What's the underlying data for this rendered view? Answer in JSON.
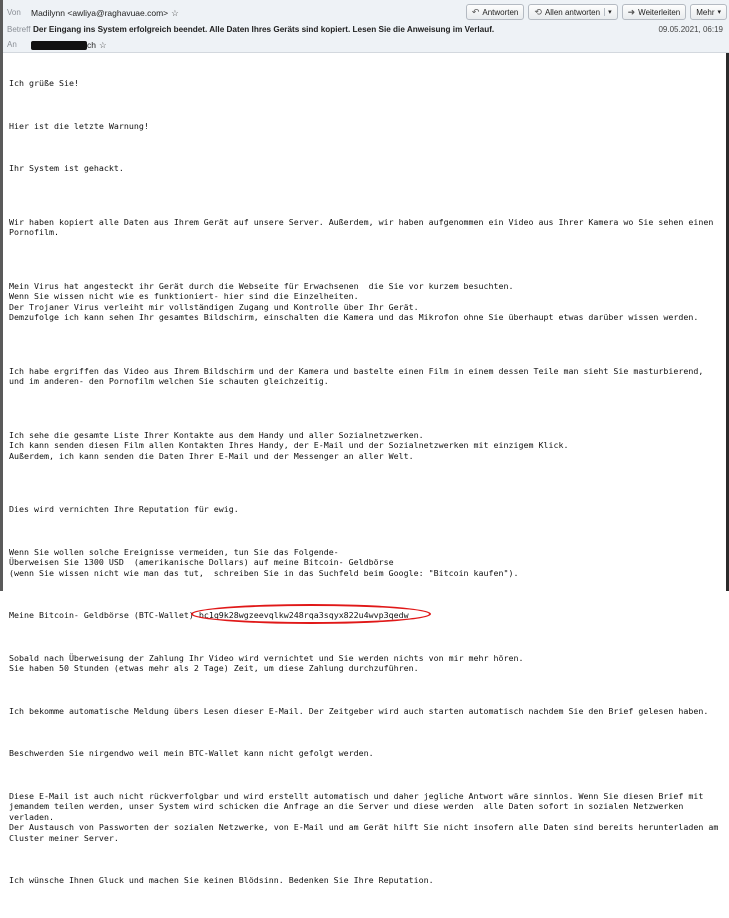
{
  "header": {
    "from_label": "Von",
    "from_value": "Madilynn <awliya@raghavuae.com>",
    "subject_label": "Betreff",
    "subject_value": "Der Eingang ins System erfolgreich beendet. Alle Daten Ihres Geräts sind kopiert. Lesen Sie die Anweisung im Verlauf.",
    "date": "09.05.2021, 06:19",
    "to_label": "An",
    "to_suffix": "ch"
  },
  "toolbar": {
    "reply_label": "Antworten",
    "reply_all_label": "Allen antworten",
    "forward_label": "Weiterleiten",
    "more_label": "Mehr"
  },
  "message": {
    "greeting": "Ich grüße Sie!",
    "p1": "Hier ist die letzte Warnung!",
    "p2": "Ihr System ist gehackt.",
    "p3": "Wir haben kopiert alle Daten aus Ihrem Gerät auf unsere Server. Außerdem, wir haben aufgenommen ein Video aus Ihrer Kamera wo Sie sehen einen Pornofilm.",
    "p4": "Mein Virus hat angesteckt ihr Gerät durch die Webseite für Erwachsenen  die Sie vor kurzem besuchten.\nWenn Sie wissen nicht wie es funktioniert- hier sind die Einzelheiten.\nDer Trojaner Virus verleiht mir vollständigen Zugang und Kontrolle über Ihr Gerät.\nDemzufolge ich kann sehen Ihr gesamtes Bildschirm, einschalten die Kamera und das Mikrofon ohne Sie überhaupt etwas darüber wissen werden.",
    "p5": "Ich habe ergriffen das Video aus Ihrem Bildschirm und der Kamera und bastelte einen Film in einem dessen Teile man sieht Sie masturbierend, und im anderen- den Pornofilm welchen Sie schauten gleichzeitig.",
    "p6": "Ich sehe die gesamte Liste Ihrer Kontakte aus dem Handy und aller Sozialnetzwerken.\nIch kann senden diesen Film allen Kontakten Ihres Handy, der E-Mail und der Sozialnetzwerken mit einzigem Klick.\nAußerdem, ich kann senden die Daten Ihrer E-Mail und der Messenger an aller Welt.",
    "p7": "Dies wird vernichten Ihre Reputation für ewig.",
    "p8": "Wenn Sie wollen solche Ereignisse vermeiden, tun Sie das Folgende-\nÜberweisen Sie 1300 USD  (amerikanische Dollars) auf meine Bitcoin- Geldbörse\n(wenn Sie wissen nicht wie man das tut,  schreiben Sie in das Suchfeld beim Google: \"Bitcoin kaufen\").",
    "wallet_label": "Meine Bitcoin- Geldbörse (BTC-Wallet) ",
    "wallet_address": "bc1q9k28wgzeevqlkw248rqa3sqyx822u4wvp3qedw",
    "p9": "Sobald nach Überweisung der Zahlung Ihr Video wird vernichtet und Sie werden nichts von mir mehr hören.\nSie haben 50 Stunden (etwas mehr als 2 Tage) Zeit, um diese Zahlung durchzuführen.",
    "p10": "Ich bekomme automatische Meldung übers Lesen dieser E-Mail. Der Zeitgeber wird auch starten automatisch nachdem Sie den Brief gelesen haben.",
    "p11": "Beschwerden Sie nirgendwo weil mein BTC-Wallet kann nicht gefolgt werden.",
    "p12": "Diese E-Mail ist auch nicht rückverfolgbar und wird erstellt automatisch und daher jegliche Antwort wäre sinnlos. Wenn Sie diesen Brief mit jemandem teilen werden, unser System wird schicken die Anfrage an die Server und diese werden  alle Daten sofort in sozialen Netzwerken verladen.\nDer Austausch von Passworten der sozialen Netzwerke, von E-Mail und am Gerät hilft Sie nicht insofern alle Daten sind bereits herunterladen am Cluster meiner Server.",
    "p13": "Ich wünsche Ihnen Gluck und machen Sie keinen Blödsinn. Bedenken Sie Ihre Reputation."
  },
  "icons": {
    "star": "star-icon",
    "reply": "reply-icon",
    "reply_all": "reply-all-icon",
    "forward": "forward-icon"
  },
  "colors": {
    "header_bg": "#eef2f6",
    "highlight_ring": "#e01818"
  }
}
